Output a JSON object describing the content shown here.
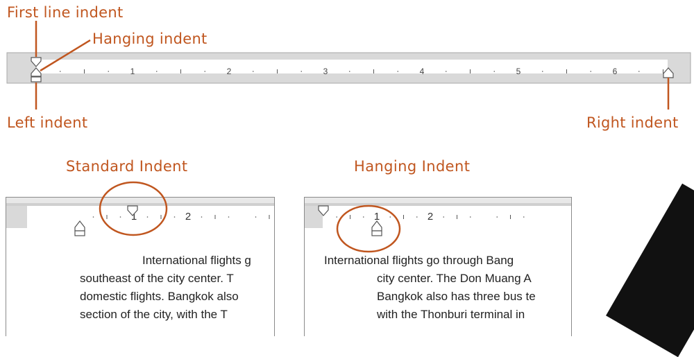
{
  "callouts": {
    "first_line": "First line indent",
    "hanging": "Hanging indent",
    "left": "Left indent",
    "right": "Right indent"
  },
  "main_ruler": {
    "numbers": [
      "1",
      "2",
      "3",
      "4",
      "5",
      "6"
    ]
  },
  "sections": {
    "standard": {
      "title": "Standard Indent",
      "ruler_numbers": [
        "1",
        "2"
      ],
      "lines": [
        "International flights g",
        "southeast of the city center. T",
        "domestic flights. Bangkok also",
        "section of the city, with the T"
      ]
    },
    "hanging": {
      "title": "Hanging Indent",
      "ruler_numbers": [
        "1",
        "2"
      ],
      "lines": [
        "International flights go through Bang",
        "city center. The Don Muang A",
        "Bangkok also has three bus te",
        "with the Thonburi terminal in"
      ]
    }
  },
  "colors": {
    "accent": "#c0561f",
    "ruler_bg": "#d9d9d9",
    "ruler_strip": "#ffffff"
  }
}
